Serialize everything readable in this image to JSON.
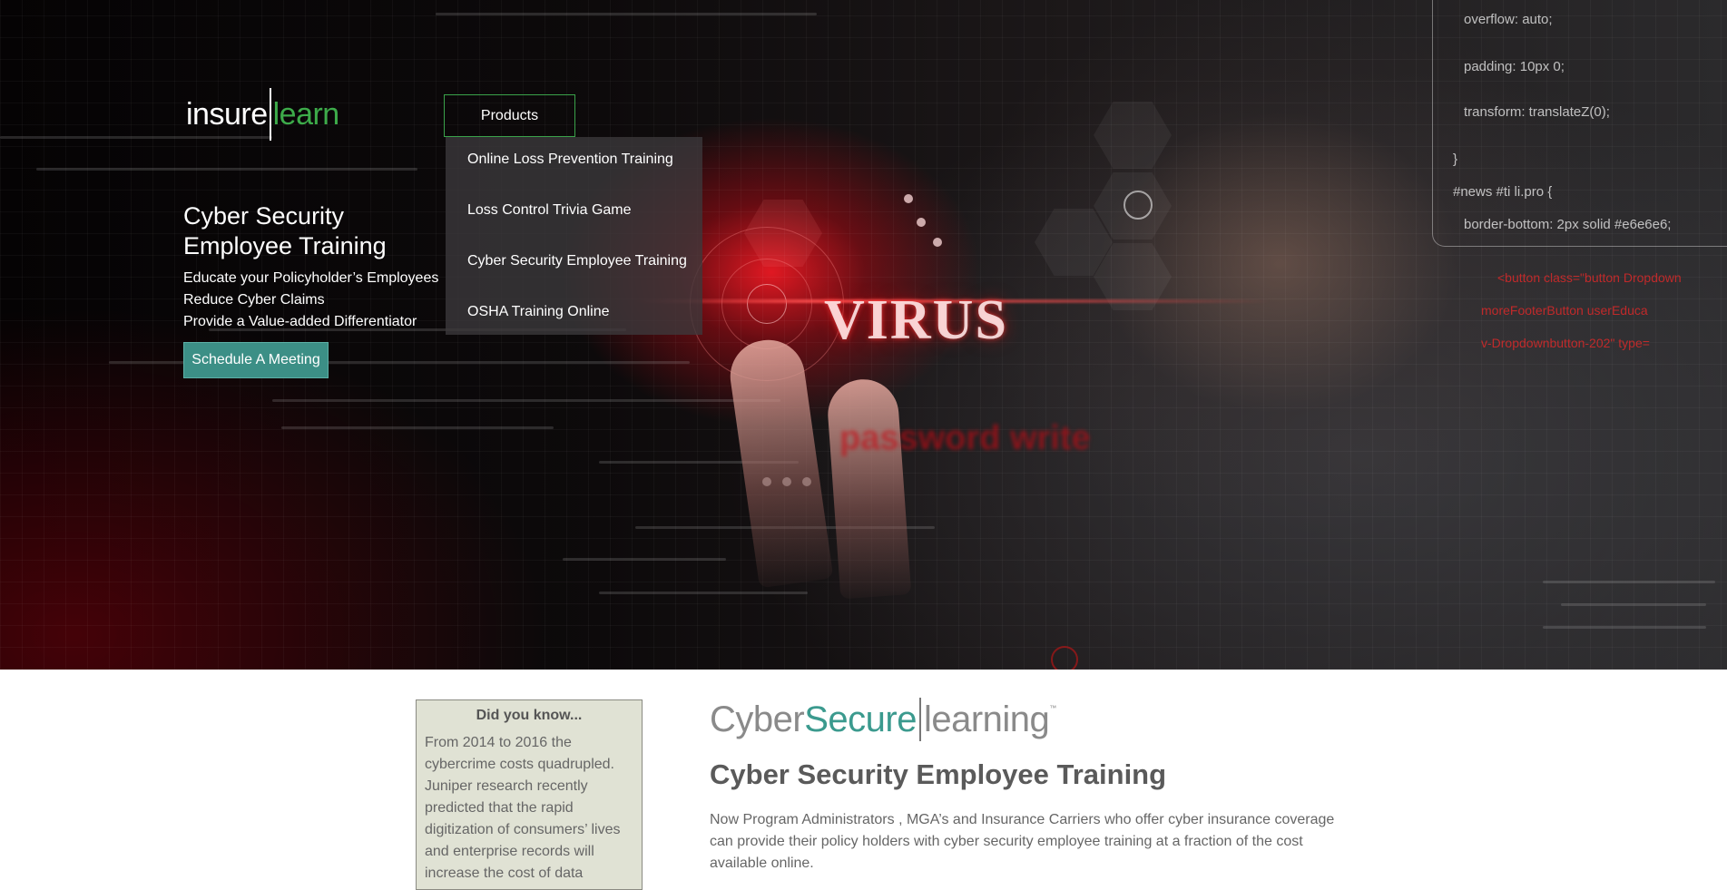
{
  "header": {
    "logo": {
      "part1": "insure",
      "part2": "learn"
    },
    "nav": {
      "products_label": "Products"
    },
    "dropdown": {
      "items": [
        {
          "label": "Online Loss Prevention Training"
        },
        {
          "label": "Loss Control Trivia Game"
        },
        {
          "label": "Cyber Security Employee Training"
        },
        {
          "label": "OSHA Training Online"
        }
      ]
    }
  },
  "hero": {
    "title_line1": "Cyber Security",
    "title_line2": "Employee Training",
    "lines": [
      "Educate your Policyholder’s Employees",
      "Reduce Cyber Claims",
      "Provide a Value-added Differentiator"
    ],
    "cta_label": "Schedule A Meeting",
    "image_text": {
      "virus": "VIRUS",
      "password": "password write"
    },
    "code_snippet": [
      "overflow: auto;",
      "padding: 10px 0;",
      "transform: translateZ(0);",
      "}",
      "#news #ti li.pro {",
      "border-bottom: 2px solid #e6e6e6;"
    ]
  },
  "did_you_know": {
    "title": "Did you know...",
    "body": "From 2014 to 2016 the cybercrime costs quadrupled. Juniper research recently predicted that the rapid digitization of consumers’ lives and enterprise records will increase the cost of data"
  },
  "product_logo": {
    "part1": "Cyber",
    "part2": "Secure",
    "part3": "learning",
    "tm": "™"
  },
  "main": {
    "title": "Cyber Security Employee Training",
    "description": "Now Program Administrators , MGA’s and Insurance Carriers who offer cyber insurance coverage can provide their policy holders with cyber security employee training at a fraction of the cost available online."
  },
  "colors": {
    "logo_green": "#3dab4a",
    "nav_border_green": "#3aa24a",
    "cta_teal": "#3c8f86",
    "secure_teal": "#3b9a8e",
    "did_you_know_bg": "#e0e2d4"
  }
}
